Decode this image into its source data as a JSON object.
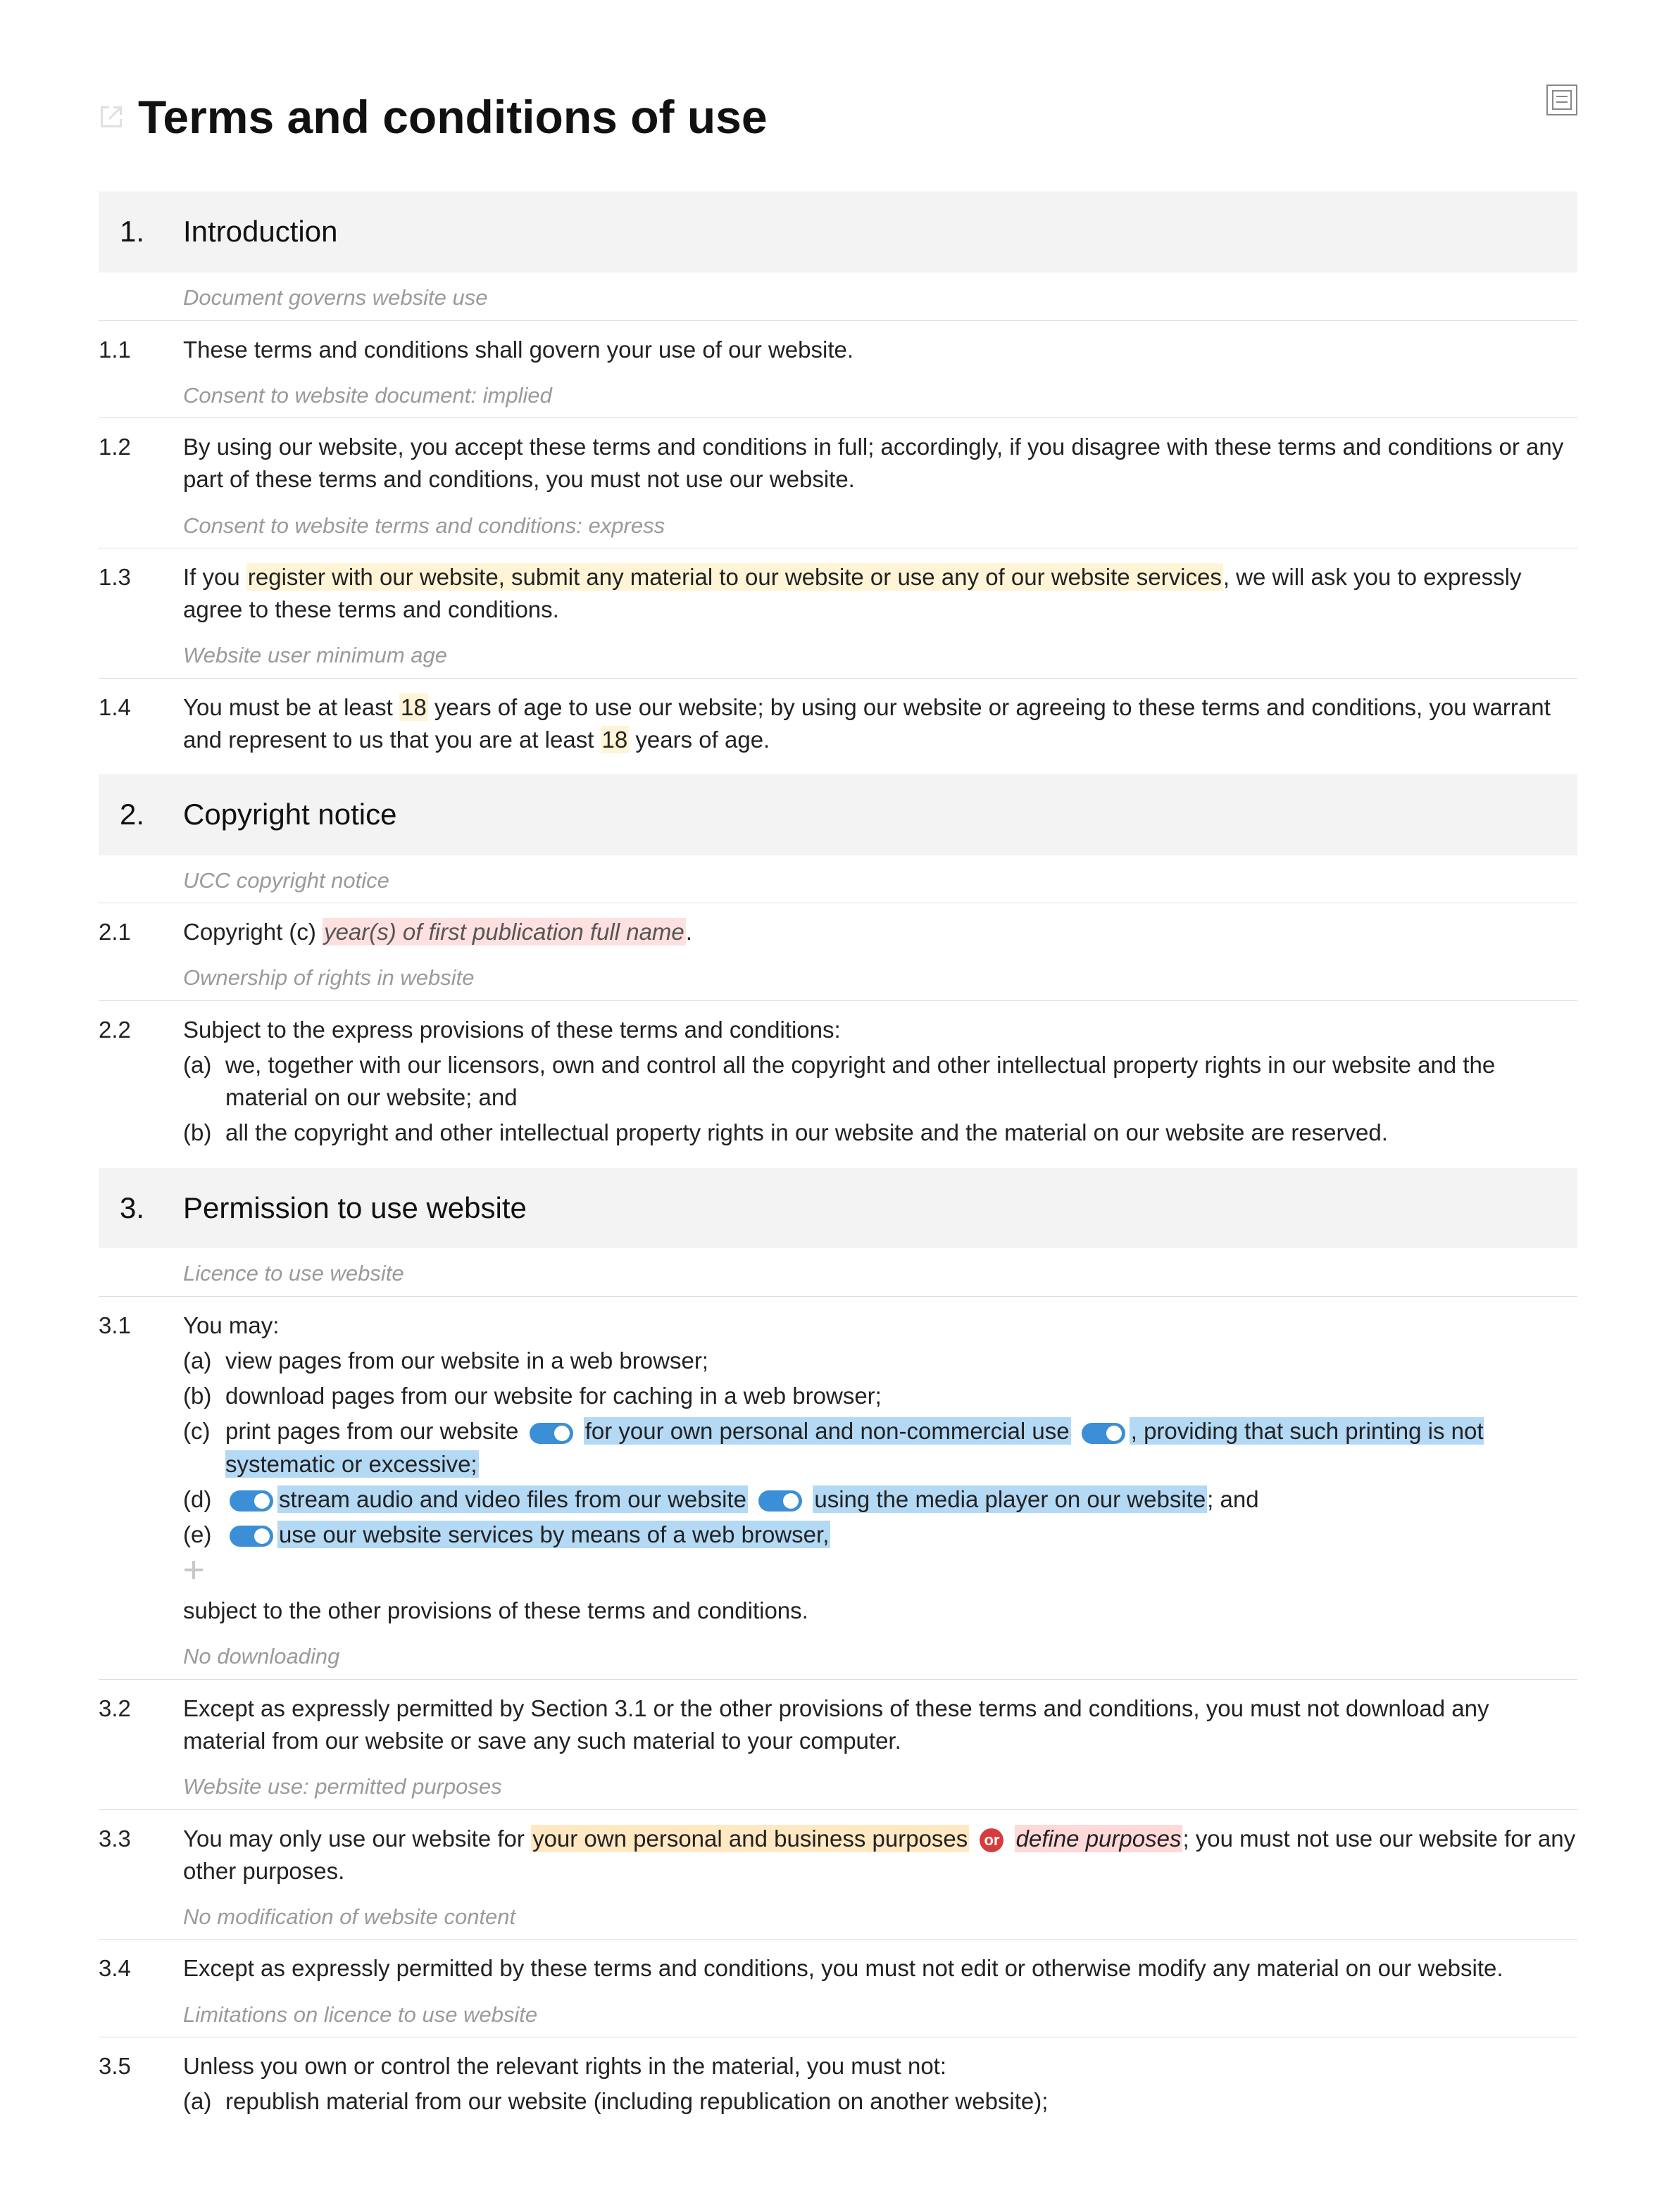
{
  "header": {
    "title": "Terms and conditions of use"
  },
  "sections": {
    "s1": {
      "num": "1.",
      "title": "Introduction"
    },
    "s2": {
      "num": "2.",
      "title": "Copyright notice"
    },
    "s3": {
      "num": "3.",
      "title": "Permission to use website"
    }
  },
  "notes": {
    "n1_1": "Document governs website use",
    "n1_2": "Consent to website document: implied",
    "n1_3": "Consent to website terms and conditions: express",
    "n1_4": "Website user minimum age",
    "n2_1": "UCC copyright notice",
    "n2_2": "Ownership of rights in website",
    "n3_1": "Licence to use website",
    "n3_2": "No downloading",
    "n3_3": "Website use: permitted purposes",
    "n3_4": "No modification of website content",
    "n3_5": "Limitations on licence to use website"
  },
  "clauses": {
    "c1_1": {
      "num": "1.1",
      "text": "These terms and conditions shall govern your use of our website."
    },
    "c1_2": {
      "num": "1.2",
      "text": "By using our website, you accept these terms and conditions in full; accordingly, if you disagree with these terms and conditions or any part of these terms and conditions, you must not use our website."
    },
    "c1_3": {
      "num": "1.3",
      "pre": "If you ",
      "hl": "register with our website, submit any material to our website or use any of our website services",
      "post": ", we will ask you to expressly agree to these terms and conditions."
    },
    "c1_4": {
      "num": "1.4",
      "pre": "You must be at least ",
      "hl1": "18",
      "mid": " years of age to use our website; by using our website or agreeing to these terms and conditions, you warrant and represent to us that you are at least ",
      "hl2": "18",
      "post": " years of age."
    },
    "c2_1": {
      "num": "2.1",
      "pre": "Copyright (c) ",
      "var": "year(s) of first publication full name",
      "post": "."
    },
    "c2_2": {
      "num": "2.2",
      "intro": "Subject to the express provisions of these terms and conditions:",
      "a": "we, together with our licensors, own and control all the copyright and other intellectual property rights in our website and the material on our website; and",
      "b": "all the copyright and other intellectual property rights in our website and the material on our website are reserved."
    },
    "c3_1": {
      "num": "3.1",
      "intro": "You may:",
      "a": "view pages from our website in a web browser;",
      "b": "download pages from our website for caching in a web browser;",
      "c_pre": "print pages from our website",
      "c_hl1": "for your own personal and non-commercial use",
      "c_hl2": ", providing that such printing is not systematic or excessive;",
      "d_hl1": "stream audio and video files from our website",
      "d_hl2": "using the media player on our website",
      "d_post": "; and",
      "e_hl": "use our website services by means of a web browser,",
      "tail": "subject to the other provisions of these terms and conditions."
    },
    "c3_2": {
      "num": "3.2",
      "text": "Except as expressly permitted by Section 3.1 or the other provisions of these terms and conditions, you must not download any material from our website or save any such material to your computer."
    },
    "c3_3": {
      "num": "3.3",
      "pre": "You may only use our website for ",
      "hl1": "your own personal and business purposes",
      "or": "or",
      "hl2": "define purposes",
      "post": "; you must not use our website for any other purposes."
    },
    "c3_4": {
      "num": "3.4",
      "text": "Except as expressly permitted by these terms and conditions, you must not edit or otherwise modify any material on our website."
    },
    "c3_5": {
      "num": "3.5",
      "intro": "Unless you own or control the relevant rights in the material, you must not:",
      "a": "republish material from our website (including republication on another website);"
    }
  },
  "labels": {
    "sub_a": "(a)",
    "sub_b": "(b)",
    "sub_c": "(c)",
    "sub_d": "(d)",
    "sub_e": "(e)"
  }
}
